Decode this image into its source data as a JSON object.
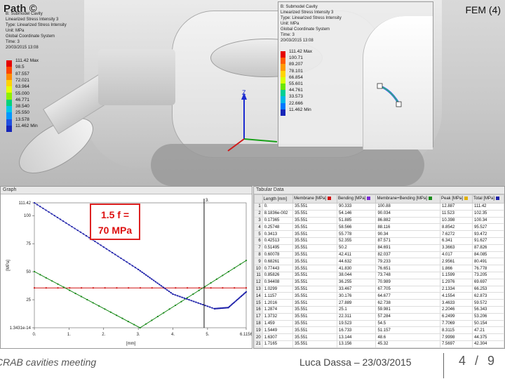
{
  "slide": {
    "title_left": "Path ©",
    "title_right": "FEM (4)"
  },
  "main_legend": {
    "info": [
      "B: Submodel Cavity",
      "Linearized Stress Intensity 3",
      "Type: Linearized Stress Intensity",
      "Unit: MPa",
      "Global Coordinate System",
      "Time: 3",
      "20/03/2015 13:08"
    ],
    "labels": [
      "111.42 Max",
      "98.5",
      "87.557",
      "72.021",
      "63.964",
      "55.000",
      "46.771",
      "38.540",
      "25.550",
      "13.578",
      "11.462 Min"
    ],
    "colors": [
      "#e50000",
      "#ff4400",
      "#ff8c00",
      "#ffd200",
      "#e6ff00",
      "#8ef000",
      "#00d27a",
      "#00c8e6",
      "#0096ff",
      "#1f4fe0",
      "#1626b8"
    ]
  },
  "inset_legend": {
    "info": [
      "B: Submodel Cavity",
      "Linearized Stress Intensity 3",
      "Type: Linearized Stress Intensity",
      "Unit: MPa",
      "Global Coordinate System",
      "Time: 3",
      "20/03/2015 13:08"
    ],
    "labels": [
      "111.42 Max",
      "100.71",
      "89.207",
      "78.101",
      "66.854",
      "55.601",
      "44.761",
      "33.573",
      "22.666",
      "11.462 Min"
    ],
    "colors": [
      "#e50000",
      "#ff5a00",
      "#ff9900",
      "#ffd500",
      "#d7ff00",
      "#6de600",
      "#00cf93",
      "#00b8e8",
      "#0078ff",
      "#1626b8"
    ]
  },
  "axis": {
    "label": "Z"
  },
  "graph_panel": {
    "header": "Graph",
    "marker_label": "3.",
    "y_axis_label": "[MPa]",
    "x_axis_label": "[mm]",
    "y_ticks": [
      "111.42",
      "100",
      "75",
      "50",
      "25",
      "1.3431e-14"
    ],
    "x_ticks": [
      "0.",
      "1.",
      "2.",
      "3.",
      "4.",
      "5.",
      "6.1156"
    ],
    "annotation_line1": "1.5 f =",
    "annotation_line2": "70 MPa"
  },
  "chart_data": {
    "type": "line",
    "title": "",
    "xlabel": "[mm]",
    "ylabel": "[MPa]",
    "xlim": [
      0,
      6.1156
    ],
    "ylim": [
      0,
      111.42
    ],
    "marker_x": 4.9,
    "series": [
      {
        "name": "Membrane",
        "color": "#d01010",
        "x": [
          0,
          6.1156
        ],
        "values": [
          35.551,
          35.551
        ]
      },
      {
        "name": "Membrane+Bending",
        "color": "#1a8a1a",
        "x": [
          0,
          3.05,
          6.1156
        ],
        "values": [
          50.1,
          0,
          60
        ]
      },
      {
        "name": "Total",
        "color": "#1f22aa",
        "x": [
          0,
          1.5,
          3.0,
          4.0,
          5.2,
          5.6,
          6.1156
        ],
        "values": [
          111.42,
          82,
          52,
          30,
          17,
          18,
          32
        ]
      }
    ]
  },
  "table_panel": {
    "header": "Tabular Data",
    "columns": [
      "Length [mm]",
      "Membrane [MPa]",
      "Bending [MPa]",
      "Membrane+Bending [MPa]",
      "Peak [MPa]",
      "Total [MPa]"
    ],
    "column_colors": [
      "",
      "#d01010",
      "#7a2bd6",
      "#1a8a1a",
      "#e0b000",
      "#1f22aa"
    ],
    "rows": [
      [
        "1",
        "0.",
        "35.551",
        "90.333",
        "100.88",
        "12.887",
        "111.42"
      ],
      [
        "2",
        "8.1836e-002",
        "35.551",
        "54.146",
        "90.034",
        "11.523",
        "102.35"
      ],
      [
        "3",
        "0.17365",
        "35.551",
        "51.885",
        "86.882",
        "10.398",
        "100.34"
      ],
      [
        "4",
        "0.25748",
        "35.551",
        "58.566",
        "88.116",
        "8.8542",
        "95.527"
      ],
      [
        "5",
        "0.3413",
        "35.551",
        "55.778",
        "90.34",
        "7.6272",
        "93.472"
      ],
      [
        "6",
        "0.42513",
        "35.551",
        "52.355",
        "87.571",
        "6.341",
        "91.627"
      ],
      [
        "7",
        "0.51495",
        "35.551",
        "50.2",
        "84.691",
        "3.3663",
        "87.826"
      ],
      [
        "8",
        "0.60078",
        "35.551",
        "42.411",
        "82.037",
        "4.017",
        "84.085"
      ],
      [
        "9",
        "0.68261",
        "35.551",
        "44.632",
        "79.233",
        "2.9561",
        "80.491"
      ],
      [
        "10",
        "0.77443",
        "35.551",
        "41.830",
        "76.651",
        "1.866",
        "76.778"
      ],
      [
        "11",
        "0.85826",
        "35.551",
        "38.044",
        "73.748",
        "1.1599",
        "73.205"
      ],
      [
        "12",
        "0.94408",
        "35.551",
        "36.255",
        "70.989",
        "1.2976",
        "69.697"
      ],
      [
        "13",
        "1.0299",
        "35.551",
        "33.467",
        "67.705",
        "2.1334",
        "66.253"
      ],
      [
        "14",
        "1.1157",
        "35.551",
        "30.176",
        "64.677",
        "4.1554",
        "62.873"
      ],
      [
        "15",
        "1.2016",
        "35.551",
        "27.889",
        "62.738",
        "3.4633",
        "59.572"
      ],
      [
        "16",
        "1.2874",
        "35.551",
        "25.1",
        "59.981",
        "2.2046",
        "56.343"
      ],
      [
        "17",
        "1.3732",
        "35.551",
        "22.311",
        "57.284",
        "6.2499",
        "53.206"
      ],
      [
        "18",
        "1.459",
        "35.551",
        "19.523",
        "54.5",
        "7.7069",
        "50.154"
      ],
      [
        "19",
        "1.5449",
        "35.551",
        "16.733",
        "51.157",
        "8.3115",
        "47.21"
      ],
      [
        "20",
        "1.6307",
        "35.551",
        "13.144",
        "48.6",
        "7.9998",
        "44.375"
      ],
      [
        "21",
        "1.7165",
        "35.551",
        "13.156",
        "45.32",
        "7.5697",
        "42.304"
      ],
      [
        "22",
        "1.8024",
        "35.551",
        "1.3566",
        "41.61",
        "7.4462",
        "40.292"
      ],
      [
        "23",
        "1.8882",
        "35.551",
        "3.5578",
        "41.023",
        "7.1209",
        "38.403"
      ],
      [
        "24",
        "1.974",
        "35.551",
        "1.7897",
        "39.163",
        "6.6728",
        "36.676"
      ]
    ]
  },
  "footer": {
    "left": "CRAB cavities meeting",
    "middle": "Luca Dassa – 23/03/2015",
    "page": "4 / 9"
  }
}
